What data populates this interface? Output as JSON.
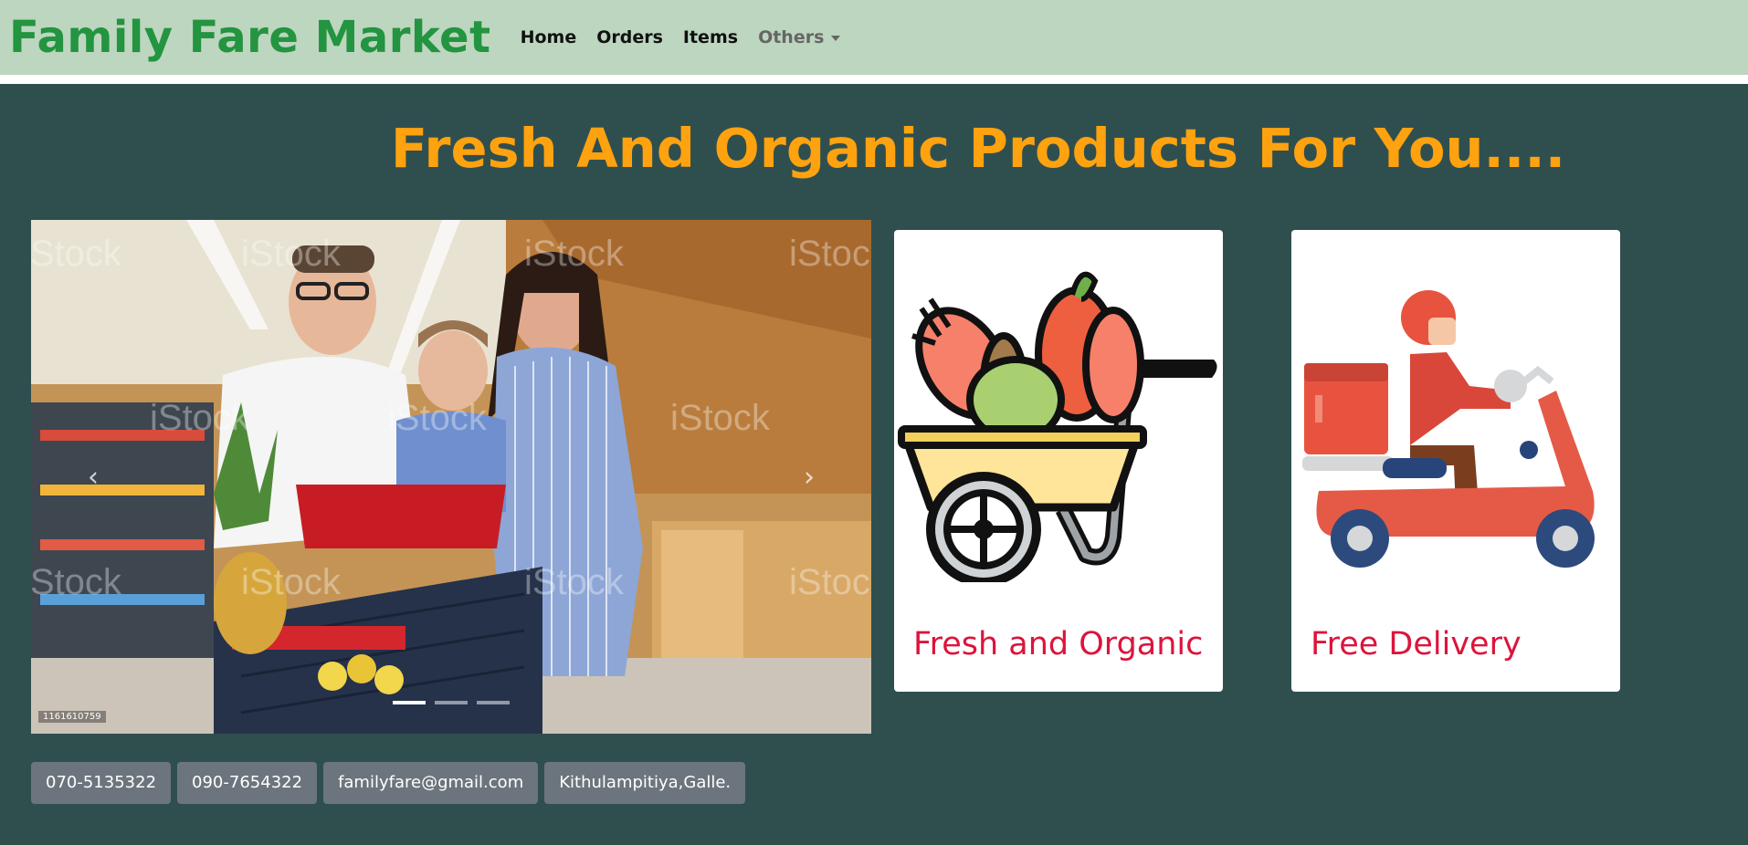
{
  "brand": "Family Fare Market",
  "nav": {
    "home": "Home",
    "orders": "Orders",
    "items": "Items",
    "others": "Others"
  },
  "headline": "Fresh And Organic Products For You....",
  "carousel": {
    "stock_id": "1161610759",
    "slide_count": 3,
    "active_slide": 1
  },
  "cards": [
    {
      "title": "Fresh and Organic",
      "icon": "vegetable-cart-icon"
    },
    {
      "title": "Free Delivery",
      "icon": "delivery-scooter-icon"
    }
  ],
  "contacts": {
    "phone1": "070-5135322",
    "phone2": "090-7654322",
    "email": "familyfare@gmail.com",
    "address": "Kithulampitiya,Galle."
  },
  "colors": {
    "navbar_bg": "#bdd6bf",
    "brand": "#23943f",
    "page_bg": "#2f4f4f",
    "headline": "#ffa20f",
    "card_title": "#dc143c",
    "badge_bg": "#6c757d"
  }
}
